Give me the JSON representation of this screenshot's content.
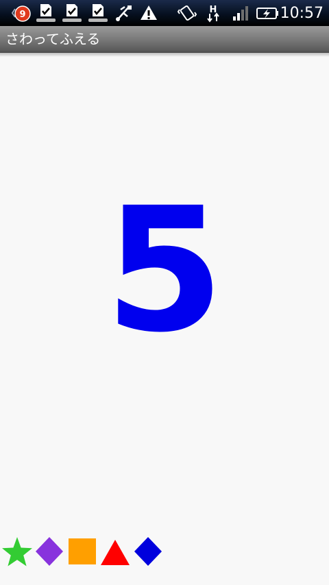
{
  "status_bar": {
    "notification_count": "9",
    "time": "10:57",
    "icons": [
      "notification-count-icon",
      "download-complete-icon",
      "download-complete-icon",
      "download-complete-icon",
      "usb-debug-icon",
      "warning-icon",
      "vibrate-icon",
      "hspa-data-icon",
      "signal-strength-icon",
      "battery-charging-icon"
    ]
  },
  "app": {
    "title": "さわってふえる",
    "counter_value": "5",
    "counter_color": "#0000ee"
  },
  "shapes": [
    {
      "name": "star-icon",
      "color": "#33cc33"
    },
    {
      "name": "diamond-icon",
      "color": "#8833dd"
    },
    {
      "name": "square-icon",
      "color": "#ff9f00"
    },
    {
      "name": "triangle-icon",
      "color": "#ff0000"
    },
    {
      "name": "diamond-icon",
      "color": "#0000dd"
    }
  ]
}
